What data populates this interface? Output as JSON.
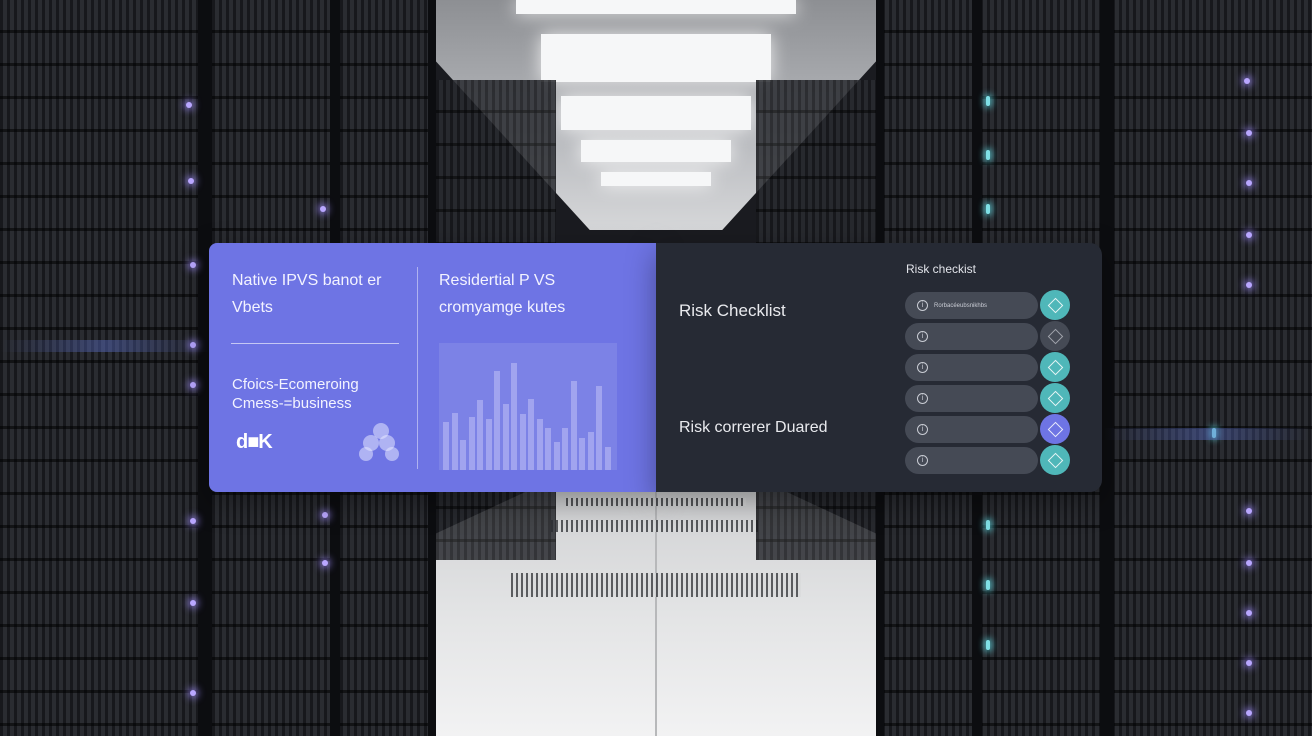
{
  "left_panel": {
    "left_column": {
      "heading_line1": "Native IPVS banot er",
      "heading_line2": "Vbets",
      "body_line1": "Cfoics-Ecomeroing",
      "body_line2": "Cmess-=business",
      "logo_text": "d■K"
    },
    "right_column": {
      "heading_line1": "Residertial P VS",
      "heading_line2": "cromyamge kutes",
      "chart_bars": [
        0.38,
        0.45,
        0.24,
        0.42,
        0.55,
        0.4,
        0.78,
        0.52,
        0.84,
        0.44,
        0.56,
        0.4,
        0.33,
        0.22,
        0.33,
        0.7,
        0.25,
        0.3,
        0.66,
        0.18
      ]
    }
  },
  "right_panel": {
    "title": "Risk Checklist",
    "subtitle": "Risk correrer Duared",
    "list_heading": "Risk checkist",
    "rows": [
      {
        "label": "Rorbacéeubsnikhbs",
        "toggle_color": "#4fb7b9",
        "active": true
      },
      {
        "label": "",
        "toggle_color": "#454a55",
        "active": false
      },
      {
        "label": "",
        "toggle_color": "#4fb7b9",
        "active": true
      },
      {
        "label": "",
        "toggle_color": "#4fb7b9",
        "active": true
      },
      {
        "label": "",
        "toggle_color": "#6e74e4",
        "active": true
      },
      {
        "label": "",
        "toggle_color": "#4fb7b9",
        "active": true
      }
    ],
    "info_glyph": "i"
  },
  "colors": {
    "accent_purple": "#6e74e4",
    "accent_teal": "#4fb7b9",
    "panel_dark": "#262a34"
  }
}
